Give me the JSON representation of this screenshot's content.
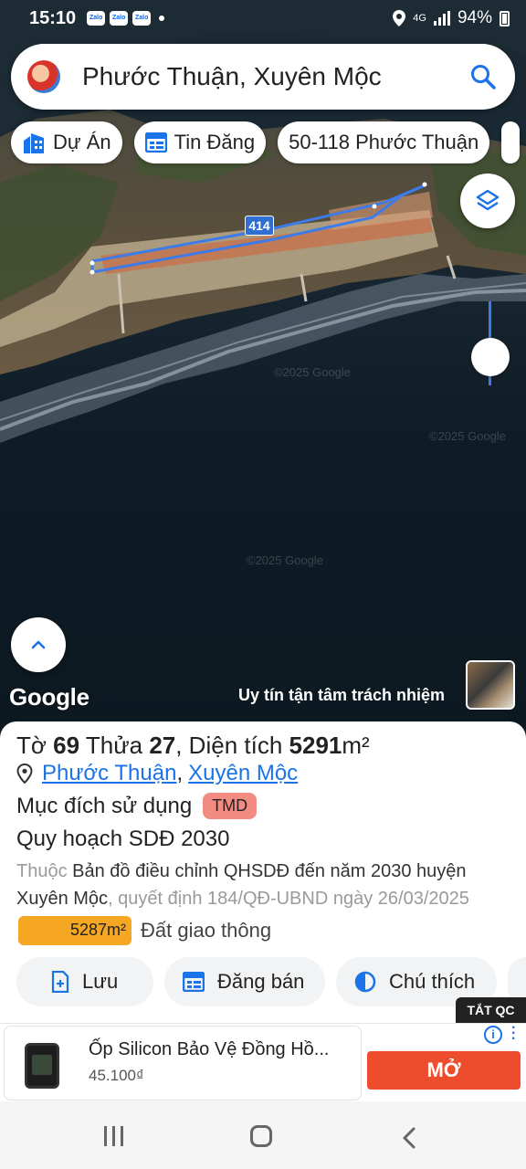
{
  "status_bar": {
    "time": "15:10",
    "notification_apps": [
      "Zalo",
      "Zalo",
      "Zalo"
    ],
    "network": "4G",
    "battery": "94%"
  },
  "search": {
    "query": "Phước Thuận, Xuyên Mộc"
  },
  "chips": [
    {
      "label": "Dự Án",
      "icon": "building-icon"
    },
    {
      "label": "Tin Đăng",
      "icon": "listing-icon"
    },
    {
      "label": "50-118 Phước Thuận",
      "icon": ""
    }
  ],
  "map": {
    "road_number": "414",
    "attribution": "Google",
    "slogan": "Uy tín tận tâm trách nhiệm",
    "watermark": "©2025 Google"
  },
  "parcel": {
    "sheet_label": "Tờ",
    "sheet_no": "69",
    "plot_label": "Thửa",
    "plot_no": "27",
    "area_label": ", Diện tích",
    "area_value": "5291",
    "area_unit": "m²",
    "ward": "Phước Thuận",
    "separator": ",",
    "district": "Xuyên Mộc",
    "purpose_label": "Mục đích sử dụng",
    "purpose_code": "TMD",
    "plan_title": "Quy hoạch SDĐ 2030",
    "plan_prefix": "Thuộc",
    "plan_doc": "Bản đồ điều chỉnh QHSDĐ đến năm 2030 huyện Xuyên Mộc",
    "plan_decision": ", quyết định 184/QĐ-UBND ngày 26/03/2025",
    "zone_area": "5287m²",
    "zone_label": "Đất giao thông",
    "zone_color": "#f5a623"
  },
  "actions": [
    {
      "label": "Lưu",
      "icon": "add-file-icon"
    },
    {
      "label": "Đăng bán",
      "icon": "listing-icon"
    },
    {
      "label": "Chú thích",
      "icon": "legend-icon"
    }
  ],
  "ad": {
    "badge": "TẮT QC",
    "title": "Ốp Silicon Bảo Vệ Đồng Hồ...",
    "price": "45.100₫",
    "button": "MỞ",
    "button_color": "#ee4d2d",
    "info": "i"
  },
  "colors": {
    "accent": "#1a73e8",
    "tag": "#f28b82",
    "map_line": "#3d7be8"
  }
}
